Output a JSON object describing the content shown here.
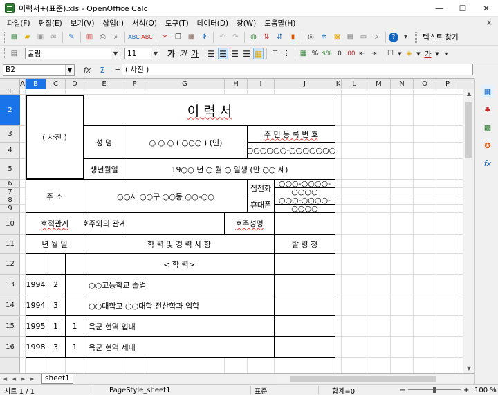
{
  "window": {
    "title": "이력서+(표준).xls - OpenOffice Calc",
    "minimize": "—",
    "maximize": "☐",
    "close": "✕"
  },
  "menu": {
    "items": [
      "파일(F)",
      "편집(E)",
      "보기(V)",
      "삽입(I)",
      "서식(O)",
      "도구(T)",
      "데이터(D)",
      "창(W)",
      "도움말(H)"
    ],
    "close": "×"
  },
  "toolbar": {
    "find_label": "텍스트 찾기",
    "font_name": "굴림",
    "font_size": "11",
    "bold": "가",
    "italic": "가",
    "underline": "가"
  },
  "formula": {
    "cell_ref": "B2",
    "fx": "fx",
    "sigma": "Σ",
    "equals": "=",
    "content": "( 사진 )"
  },
  "columns": [
    "A",
    "B",
    "C",
    "D",
    "E",
    "F",
    "G",
    "H",
    "I",
    "J",
    "K",
    "L",
    "M",
    "N",
    "O",
    "P"
  ],
  "selected_column": "B",
  "rows": [
    "1",
    "2",
    "3",
    "4",
    "5",
    "6",
    "7",
    "8",
    "9",
    "10",
    "11",
    "12",
    "13",
    "14",
    "15",
    "16"
  ],
  "selected_row": "2",
  "form": {
    "photo": "( 사진 )",
    "title": "이      력      서",
    "name_label": "성    명",
    "name_value": "○ ○ ○ ( ○○○ )  (인)",
    "rrn_label": "주 민 등 록 번 호",
    "rrn_value": "○○○○○○-○○○○○○○",
    "birth_label": "생년월일",
    "birth_value": "19○○  년 ○  월  ○   일생 (만   ○○   세)",
    "address_label": "주          소",
    "address_value": "○○시 ○○구 ○○동 ○○-○○",
    "home_phone_label": "집전화",
    "home_phone_1": "○○○-○○○○-",
    "home_phone_2": "○○○○",
    "mobile_label": "휴대폰",
    "mobile_1": "○○○-○○○○-",
    "mobile_2": "○○○○",
    "family_rel_label": "호적관계",
    "head_rel_label": "호주와의 관계",
    "head_name_label": "호주성명",
    "date_header": "년  월  일",
    "history_header": "학 력 및 경 력 사 항",
    "issuer_header": "발 령 청",
    "section_education": "< 학  력>",
    "entries": [
      {
        "year": "1994",
        "month": "2",
        "day": "",
        "text": "○○고등학교 졸업"
      },
      {
        "year": "1994",
        "month": "3",
        "day": "",
        "text": "○○대학교 ○○대학 전산학과 입학"
      },
      {
        "year": "1995",
        "month": "1",
        "day": "1",
        "text": "육군 현역 입대"
      },
      {
        "year": "1998",
        "month": "3",
        "day": "1",
        "text": "육군 현역 제대"
      }
    ]
  },
  "tabs": {
    "sheet_name": "sheet1"
  },
  "status": {
    "sheet": "시트 1 / 1",
    "page_style": "PageStyle_sheet1",
    "mode": "표준",
    "sum": "합계=0",
    "zoom": "100 %"
  }
}
